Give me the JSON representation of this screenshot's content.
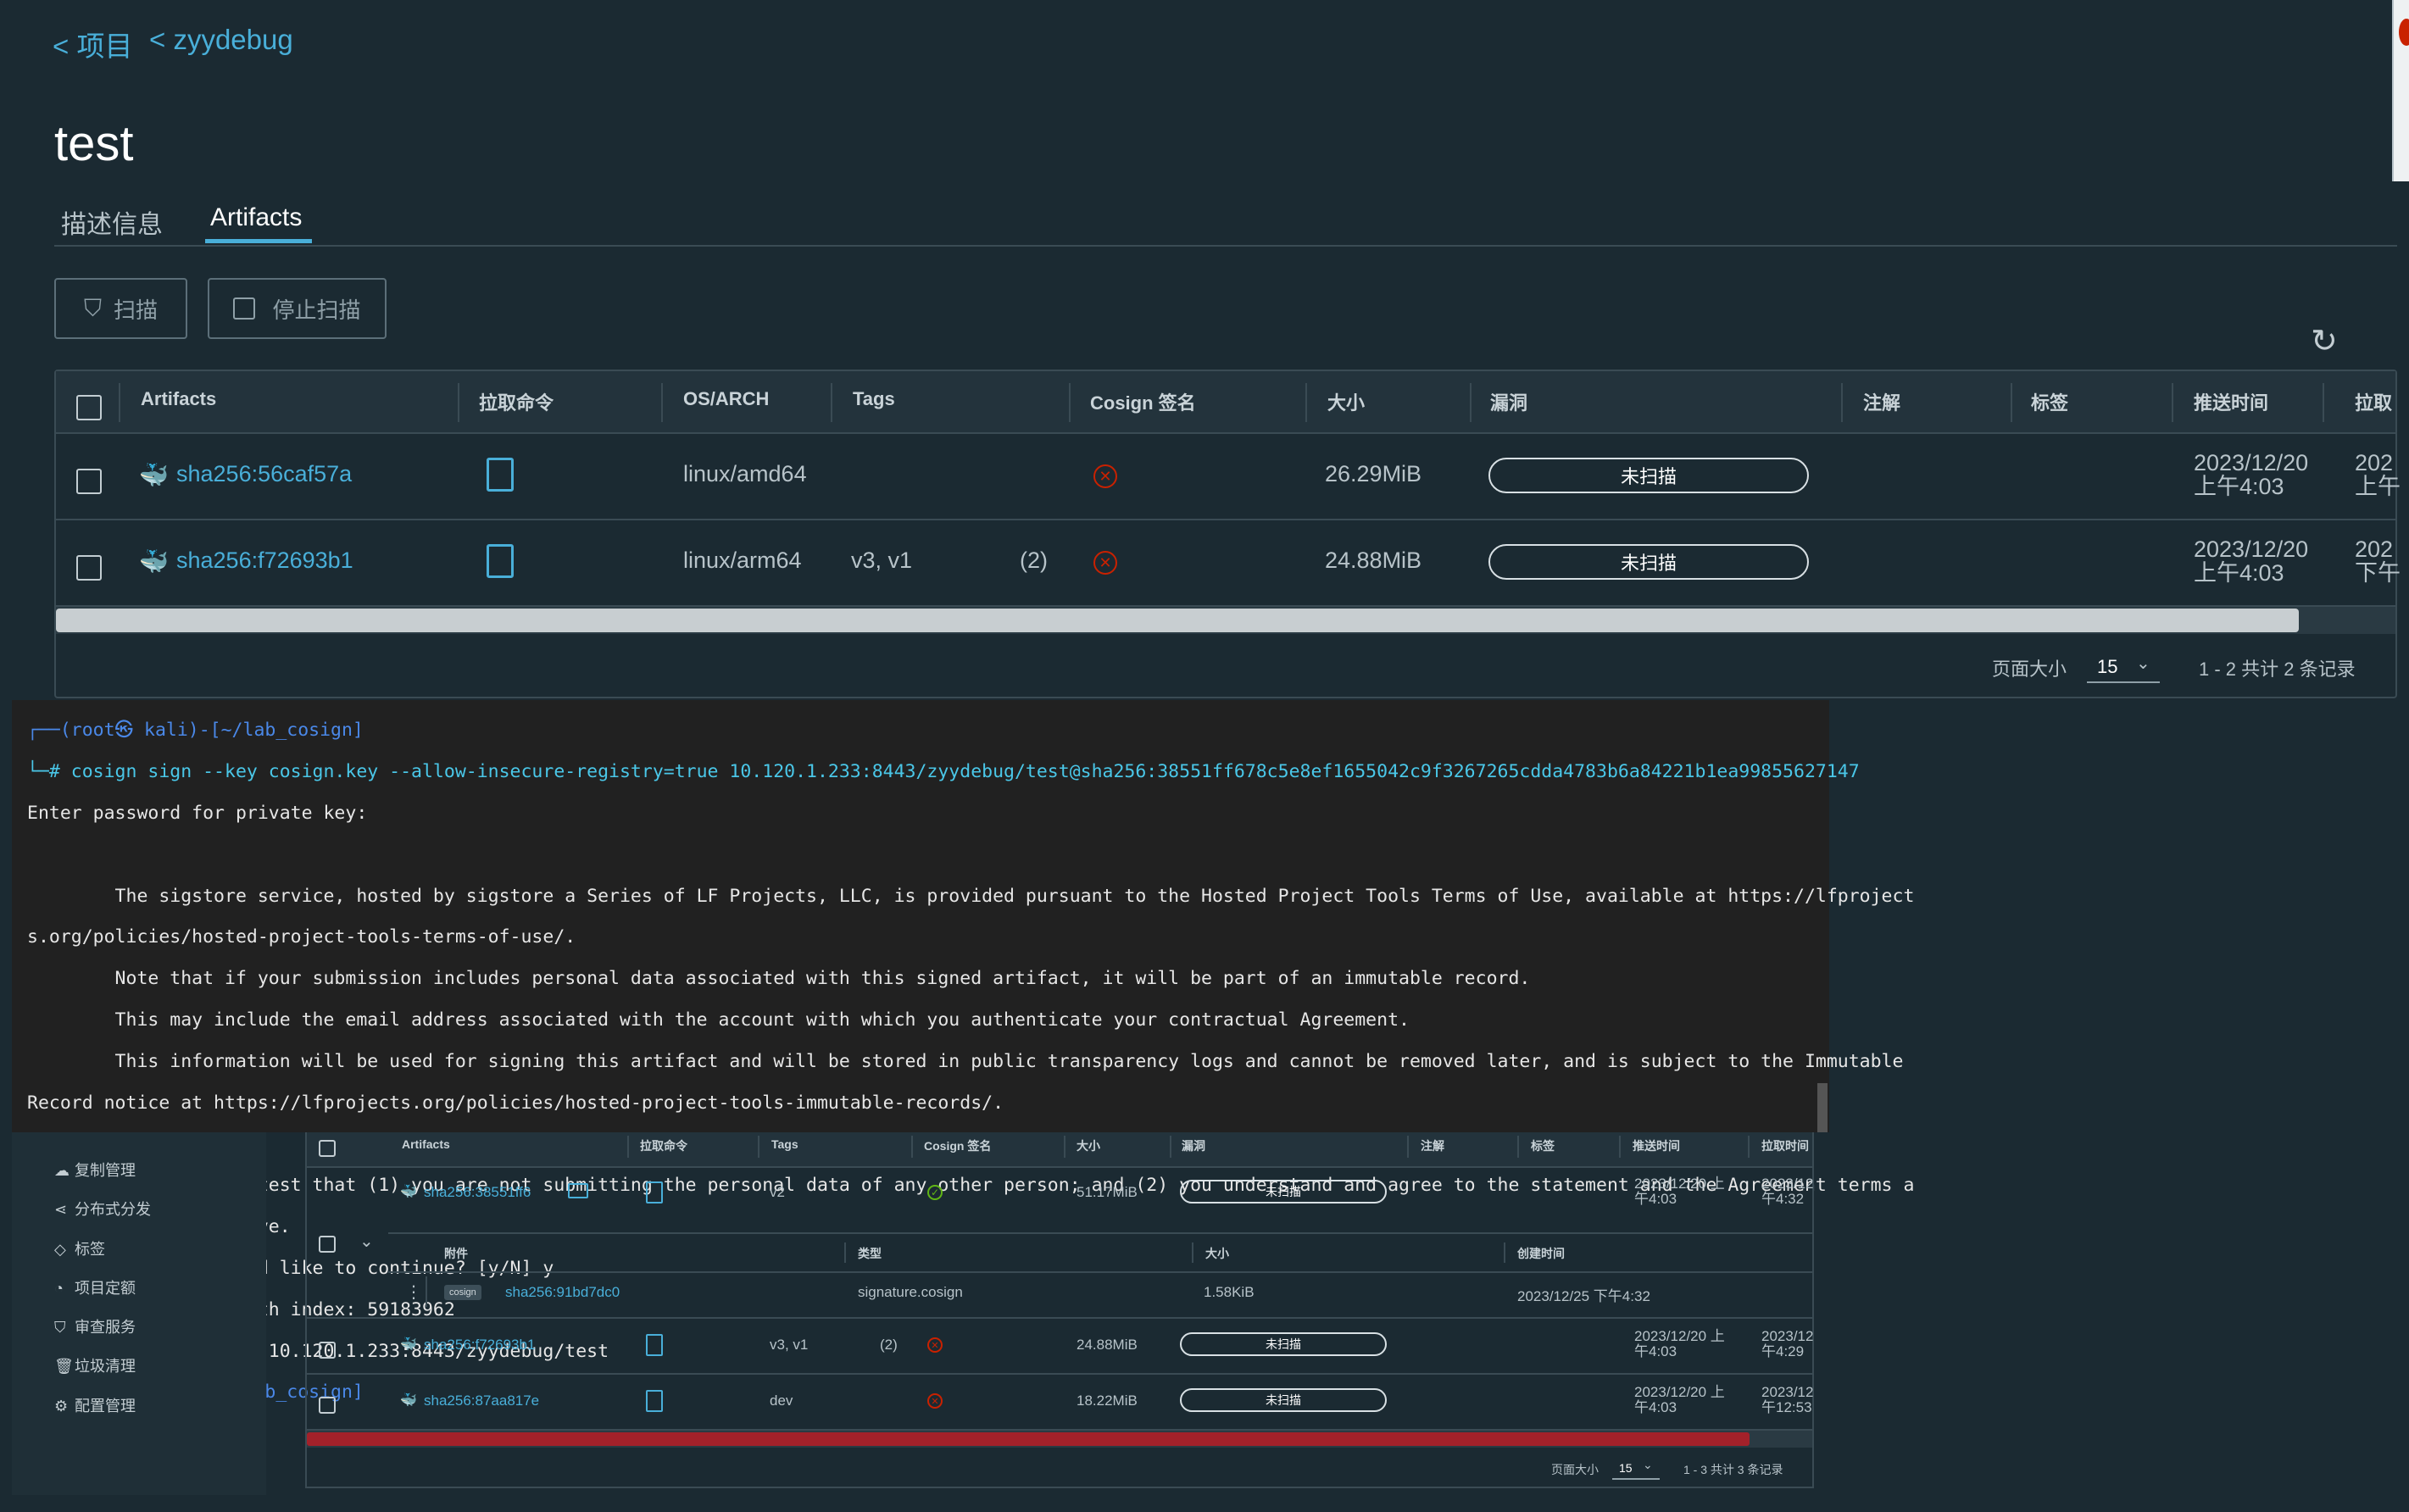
{
  "breadcrumb": {
    "projects": "< 项目",
    "project": "< zyydebug"
  },
  "page_title": "test",
  "tabs": [
    {
      "label": "描述信息",
      "active": false
    },
    {
      "label": "Artifacts",
      "active": true
    }
  ],
  "toolbar": {
    "scan_label": "扫描",
    "stop_scan_label": "停止扫描"
  },
  "table": {
    "columns": [
      "Artifacts",
      "拉取命令",
      "OS/ARCH",
      "Tags",
      "Cosign 签名",
      "大小",
      "漏洞",
      "注解",
      "标签",
      "推送时间",
      "拉取"
    ],
    "rows": [
      {
        "digest": "sha256:56caf57a",
        "os_arch": "linux/amd64",
        "tags": "",
        "tag_count": "",
        "size": "26.29MiB",
        "vuln": "未扫描",
        "push_time_l1": "2023/12/20",
        "push_time_l2": "上午4:03",
        "pull_time_l1": "202",
        "pull_time_l2": "上午"
      },
      {
        "digest": "sha256:f72693b1",
        "os_arch": "linux/arm64",
        "tags": "v3, v1",
        "tag_count": "(2)",
        "size": "24.88MiB",
        "vuln": "未扫描",
        "push_time_l1": "2023/12/20",
        "push_time_l2": "上午4:03",
        "pull_time_l1": "202",
        "pull_time_l2": "下午"
      }
    ],
    "page_size_label": "页面大小",
    "page_size": "15",
    "pagination": "1 - 2 共计 2 条记录"
  },
  "terminal": {
    "lines": [
      "┌──(root㉿ kali)-[~/lab_cosign]",
      "└─# cosign sign --key cosign.key --allow-insecure-registry=true 10.120.1.233:8443/zyydebug/test@sha256:38551ff678c5e8ef1655042c9f3267265cdda4783b6a84221b1ea99855627147",
      "Enter password for private key:",
      "",
      "        The sigstore service, hosted by sigstore a Series of LF Projects, LLC, is provided pursuant to the Hosted Project Tools Terms of Use, available at https://lfproject",
      "s.org/policies/hosted-project-tools-terms-of-use/.",
      "        Note that if your submission includes personal data associated with this signed artifact, it will be part of an immutable record.",
      "        This may include the email address associated with the account with which you authenticate your contractual Agreement.",
      "        This information will be used for signing this artifact and will be stored in public transparency logs and cannot be removed later, and is subject to the Immutable",
      "Record notice at https://lfprojects.org/policies/hosted-project-tools-immutable-records/.",
      "",
      "By typing 'y', you attest that (1) you are not submitting the personal data of any other person; and (2) you understand and agree to the statement and the Agreement terms a",
      "t the URLs listed above.",
      "Are you sure you would like to continue? [y/N] y",
      "tlog entry created with index: 59183962",
      "Pushing signature to: 10.120.1.233:8443/zyydebug/test",
      "┌──(root㉿ kali)-[~/lab_cosign]",
      "└─#"
    ]
  },
  "sidebar": {
    "items": [
      {
        "label": "复制管理",
        "icon": "replication-icon"
      },
      {
        "label": "分布式分发",
        "icon": "share-icon"
      },
      {
        "label": "标签",
        "icon": "tag-icon"
      },
      {
        "label": "项目定额",
        "icon": "quota-icon"
      },
      {
        "label": "审查服务",
        "icon": "shield-icon"
      },
      {
        "label": "垃圾清理",
        "icon": "trash-icon"
      },
      {
        "label": "配置管理",
        "icon": "gear-icon"
      }
    ]
  },
  "table2": {
    "columns": [
      "Artifacts",
      "拉取命令",
      "Tags",
      "Cosign 签名",
      "大小",
      "漏洞",
      "注解",
      "标签",
      "推送时间",
      "拉取时间"
    ],
    "rows": [
      {
        "digest": "sha256:38551ff6",
        "tags": "v2",
        "tag_count": "",
        "signed": true,
        "size": "51.17MiB",
        "vuln": "未扫描",
        "push_l1": "2023/12/20 上",
        "push_l2": "午4:03",
        "pull_l1": "2023/12",
        "pull_l2": "午4:32"
      },
      {
        "digest": "sha256:f72693b1",
        "tags": "v3, v1",
        "tag_count": "(2)",
        "signed": false,
        "size": "24.88MiB",
        "vuln": "未扫描",
        "push_l1": "2023/12/20 上",
        "push_l2": "午4:03",
        "pull_l1": "2023/12",
        "pull_l2": "午4:29"
      },
      {
        "digest": "sha256:87aa817e",
        "tags": "dev",
        "tag_count": "",
        "signed": false,
        "size": "18.22MiB",
        "vuln": "未扫描",
        "push_l1": "2023/12/20 上",
        "push_l2": "午4:03",
        "pull_l1": "2023/12",
        "pull_l2": "午12:53"
      }
    ],
    "accessory": {
      "columns": [
        "附件",
        "类型",
        "大小",
        "创建时间"
      ],
      "badge": "cosign",
      "digest": "sha256:91bd7dc0",
      "type": "signature.cosign",
      "size": "1.58KiB",
      "created": "2023/12/25 下午4:32"
    },
    "page_size_label": "页面大小",
    "page_size": "15",
    "pagination": "1 - 3 共计 3 条记录"
  },
  "colors": {
    "background": "#1b2a32",
    "link": "#49afd9",
    "danger": "#c92100",
    "success": "#60b515",
    "terminal_bg": "#212121"
  }
}
